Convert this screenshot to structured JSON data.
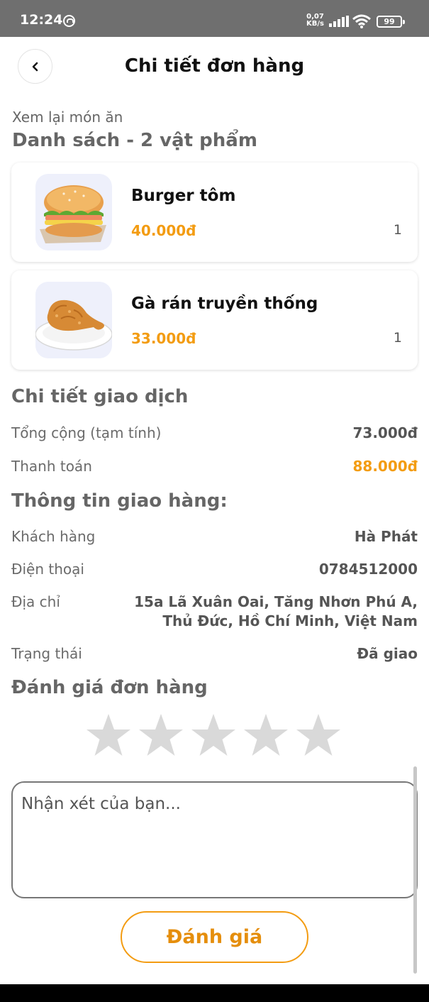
{
  "status_bar": {
    "time": "12:24",
    "speed_value": "0,07",
    "speed_unit": "KB/s",
    "battery": "99"
  },
  "header": {
    "title": "Chi tiết đơn hàng"
  },
  "items_section": {
    "caption": "Xem lại món ăn",
    "heading": "Danh sách - 2 vật phẩm"
  },
  "items": [
    {
      "name": "Burger tôm",
      "price": "40.000đ",
      "quantity": "1",
      "image_icon": "burger-image"
    },
    {
      "name": "Gà rán truyền thống",
      "price": "33.000đ",
      "quantity": "1",
      "image_icon": "fried-chicken-image"
    }
  ],
  "transaction": {
    "heading": "Chi tiết giao dịch",
    "subtotal_label": "Tổng cộng (tạm tính)",
    "subtotal_value": "73.000đ",
    "payment_label": "Thanh toán",
    "payment_value": "88.000đ"
  },
  "delivery": {
    "heading": "Thông tin giao hàng:",
    "customer_label": "Khách hàng",
    "customer_value": "Hà Phát",
    "phone_label": "Điện thoại",
    "phone_value": "0784512000",
    "address_label": "Địa chỉ",
    "address_line1": "15a Lã Xuân Oai, Tăng Nhơn Phú A,",
    "address_line2": "Thủ Đức, Hồ Chí Minh, Việt Nam",
    "status_label": "Trạng thái",
    "status_value": "Đã giao"
  },
  "rating": {
    "heading": "Đánh giá đơn hàng",
    "stars_total": 5,
    "stars_selected": 0,
    "comment_placeholder": "Nhận xét của bạn...",
    "submit_label": "Đánh giá"
  },
  "colors": {
    "accent": "#f39c12",
    "star_empty": "#d9d9d9",
    "status_bar": "#6f6f6f"
  }
}
